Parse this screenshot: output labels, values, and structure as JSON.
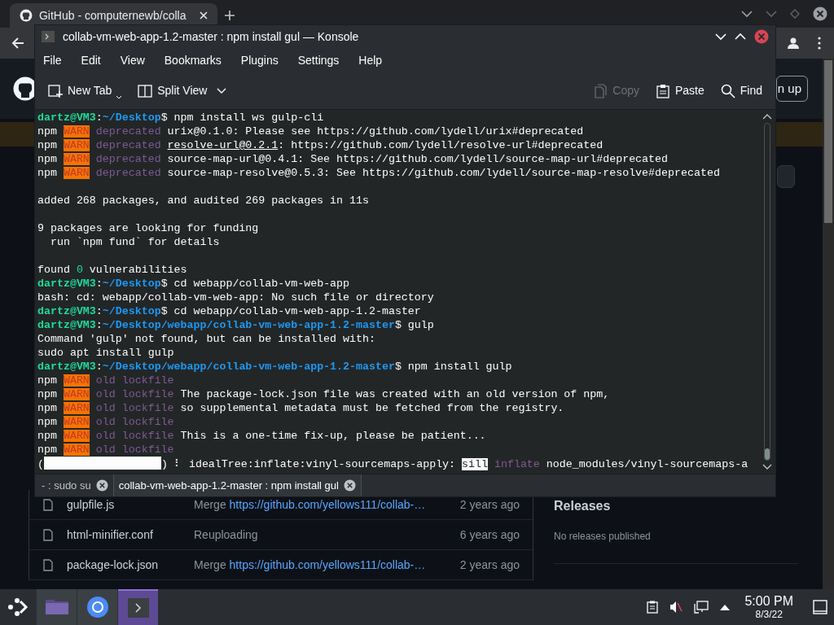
{
  "browser": {
    "tab_title": "GitHub - computernewb/colla",
    "sign_up_partial": "n up",
    "files": [
      {
        "name": "gulpfile.js",
        "message": "Merge",
        "link": "https://github.com/yellows111/collab-…",
        "age": "2 years ago"
      },
      {
        "name": "html-minifier.conf",
        "message": "Reuploading",
        "age": "6 years ago"
      },
      {
        "name": "package-lock.json",
        "message": "Merge",
        "link": "https://github.com/yellows111/collab-…",
        "age": "2 years ago"
      }
    ],
    "releases_heading": "Releases",
    "releases_text": "No releases published"
  },
  "konsole": {
    "title": "collab-vm-web-app-1.2-master : npm install gul — Konsole",
    "menu": [
      "File",
      "Edit",
      "View",
      "Bookmarks",
      "Plugins",
      "Settings",
      "Help"
    ],
    "toolbar": [
      {
        "kind": "new-tab",
        "label": "New Tab",
        "disabled": false
      },
      {
        "kind": "split",
        "label": "Split View",
        "disabled": false
      },
      {
        "kind": "copy",
        "label": "Copy",
        "disabled": true
      },
      {
        "kind": "paste",
        "label": "Paste",
        "disabled": false
      },
      {
        "kind": "find",
        "label": "Find",
        "disabled": false
      }
    ],
    "lines": [
      {
        "segments": [
          {
            "kind": "user",
            "text": "dartz@VM3"
          },
          {
            "kind": "text",
            "text": ":"
          },
          {
            "kind": "path",
            "text": "~/Desktop"
          },
          {
            "kind": "text",
            "text": "$ npm install ws gulp-cli"
          }
        ]
      },
      {
        "segments": [
          {
            "kind": "text",
            "text": "npm "
          },
          {
            "kind": "warn",
            "text": "WARN"
          },
          {
            "kind": "dim",
            "text": " deprecated"
          },
          {
            "kind": "text",
            "text": " urix@0.1.0: Please see https://github.com/lydell/urix#deprecated"
          }
        ]
      },
      {
        "segments": [
          {
            "kind": "text",
            "text": "npm "
          },
          {
            "kind": "warn",
            "text": "WARN"
          },
          {
            "kind": "dim",
            "text": " deprecated "
          },
          {
            "kind": "underline",
            "text": "resolve-url@0.2.1"
          },
          {
            "kind": "text",
            "text": ": https://github.com/lydell/resolve-url#deprecated"
          }
        ]
      },
      {
        "segments": [
          {
            "kind": "text",
            "text": "npm "
          },
          {
            "kind": "warn",
            "text": "WARN"
          },
          {
            "kind": "dim",
            "text": " deprecated"
          },
          {
            "kind": "text",
            "text": " source-map-url@0.4.1: See https://github.com/lydell/source-map-url#deprecated"
          }
        ]
      },
      {
        "segments": [
          {
            "kind": "text",
            "text": "npm "
          },
          {
            "kind": "warn",
            "text": "WARN"
          },
          {
            "kind": "dim",
            "text": " deprecated"
          },
          {
            "kind": "text",
            "text": " source-map-resolve@0.5.3: See https://github.com/lydell/source-map-resolve#deprecated"
          }
        ]
      },
      {
        "gap_before": true,
        "segments": [
          {
            "kind": "text",
            "text": "added 268 packages, and audited 269 packages in 11s"
          }
        ]
      },
      {
        "gap_before": true,
        "segments": [
          {
            "kind": "text",
            "text": "9 packages are looking for funding"
          }
        ]
      },
      {
        "segments": [
          {
            "kind": "text",
            "text": "  run `npm fund` for details"
          }
        ]
      },
      {
        "gap_before": true,
        "segments": [
          {
            "kind": "text",
            "text": "found "
          },
          {
            "kind": "number",
            "text": "0"
          },
          {
            "kind": "text",
            "text": " vulnerabilities"
          }
        ]
      },
      {
        "segments": [
          {
            "kind": "user",
            "text": "dartz@VM3"
          },
          {
            "kind": "text",
            "text": ":"
          },
          {
            "kind": "path",
            "text": "~/Desktop"
          },
          {
            "kind": "text",
            "text": "$ cd webapp/collab-vm-web-app"
          }
        ]
      },
      {
        "segments": [
          {
            "kind": "text",
            "text": "bash: cd: webapp/collab-vm-web-app: No such file or directory"
          }
        ]
      },
      {
        "segments": [
          {
            "kind": "user",
            "text": "dartz@VM3"
          },
          {
            "kind": "text",
            "text": ":"
          },
          {
            "kind": "path",
            "text": "~/Desktop"
          },
          {
            "kind": "text",
            "text": "$ cd webapp/collab-vm-web-app-1.2-master"
          }
        ]
      },
      {
        "segments": [
          {
            "kind": "user",
            "text": "dartz@VM3"
          },
          {
            "kind": "text",
            "text": ":"
          },
          {
            "kind": "path",
            "text": "~/Desktop/webapp/collab-vm-web-app-1.2-master"
          },
          {
            "kind": "text",
            "text": "$ gulp"
          }
        ]
      },
      {
        "segments": [
          {
            "kind": "text",
            "text": "Command 'gulp' not found, but can be installed with:"
          }
        ]
      },
      {
        "segments": [
          {
            "kind": "text",
            "text": "sudo apt install gulp"
          }
        ]
      },
      {
        "segments": [
          {
            "kind": "user",
            "text": "dartz@VM3"
          },
          {
            "kind": "text",
            "text": ":"
          },
          {
            "kind": "path",
            "text": "~/Desktop/webapp/collab-vm-web-app-1.2-master"
          },
          {
            "kind": "text",
            "text": "$ npm install gulp"
          }
        ]
      },
      {
        "segments": [
          {
            "kind": "text",
            "text": "npm "
          },
          {
            "kind": "warn",
            "text": "WARN"
          },
          {
            "kind": "dim",
            "text": " old lockfile"
          }
        ]
      },
      {
        "segments": [
          {
            "kind": "text",
            "text": "npm "
          },
          {
            "kind": "warn",
            "text": "WARN"
          },
          {
            "kind": "dim",
            "text": " old lockfile"
          },
          {
            "kind": "text",
            "text": " The package-lock.json file was created with an old version of npm,"
          }
        ]
      },
      {
        "segments": [
          {
            "kind": "text",
            "text": "npm "
          },
          {
            "kind": "warn",
            "text": "WARN"
          },
          {
            "kind": "dim",
            "text": " old lockfile"
          },
          {
            "kind": "text",
            "text": " so supplemental metadata must be fetched from the registry."
          }
        ]
      },
      {
        "segments": [
          {
            "kind": "text",
            "text": "npm "
          },
          {
            "kind": "warn",
            "text": "WARN"
          },
          {
            "kind": "dim",
            "text": " old lockfile"
          }
        ]
      },
      {
        "segments": [
          {
            "kind": "text",
            "text": "npm "
          },
          {
            "kind": "warn",
            "text": "WARN"
          },
          {
            "kind": "dim",
            "text": " old lockfile"
          },
          {
            "kind": "text",
            "text": " This is a one-time fix-up, please be patient..."
          }
        ]
      },
      {
        "segments": [
          {
            "kind": "text",
            "text": "npm "
          },
          {
            "kind": "warn",
            "text": "WARN"
          },
          {
            "kind": "dim",
            "text": " old lockfile"
          }
        ]
      },
      {
        "segments": [
          {
            "kind": "text",
            "text": "("
          },
          {
            "kind": "bar"
          },
          {
            "kind": "text",
            "text": ") ⠇ idealTree:inflate:vinyl-sourcemaps-apply: "
          },
          {
            "kind": "highlight",
            "text": "sill"
          },
          {
            "kind": "dim",
            "text": " inflate"
          },
          {
            "kind": "text",
            "text": " node_modules/vinyl-sourcemaps-a"
          }
        ]
      }
    ],
    "tabs": [
      {
        "label": "- : sudo su",
        "selected": false
      },
      {
        "label": "collab-vm-web-app-1.2-master : npm install gul",
        "selected": true
      }
    ]
  },
  "taskbar": {
    "apps": [
      {
        "kind": "files",
        "selected": false
      },
      {
        "kind": "browser",
        "selected": false
      },
      {
        "kind": "terminal",
        "selected": true
      }
    ],
    "time": "5:00 PM",
    "date": "8/3/22"
  }
}
